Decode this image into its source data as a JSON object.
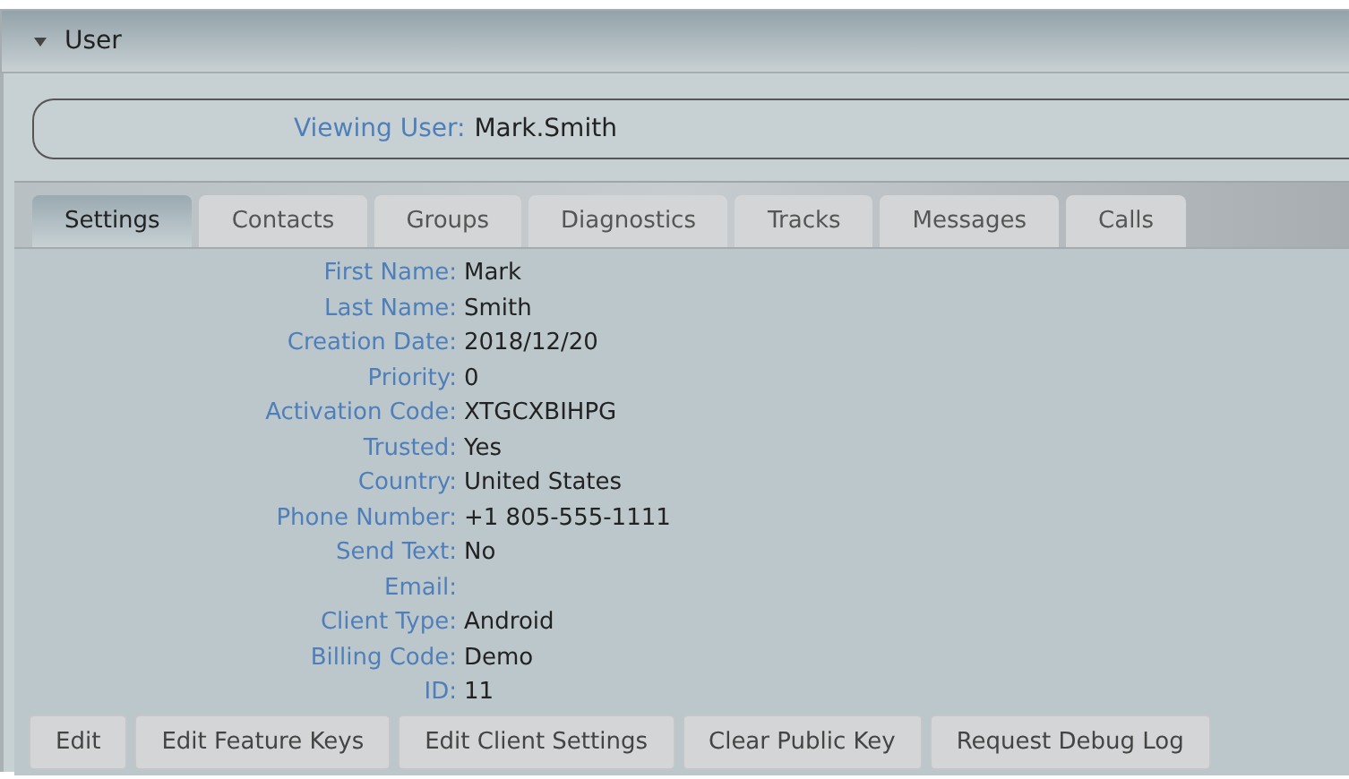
{
  "panel": {
    "title": "User",
    "expanded": true
  },
  "viewing": {
    "label": "Viewing User:",
    "value": "Mark.Smith"
  },
  "tabs": [
    {
      "label": "Settings",
      "selected": true
    },
    {
      "label": "Contacts",
      "selected": false
    },
    {
      "label": "Groups",
      "selected": false
    },
    {
      "label": "Diagnostics",
      "selected": false
    },
    {
      "label": "Tracks",
      "selected": false
    },
    {
      "label": "Messages",
      "selected": false
    },
    {
      "label": "Calls",
      "selected": false
    }
  ],
  "fields": [
    {
      "label": "First Name:",
      "value": "Mark"
    },
    {
      "label": "Last Name:",
      "value": "Smith"
    },
    {
      "label": "Creation Date:",
      "value": "2018/12/20"
    },
    {
      "label": "Priority:",
      "value": "0"
    },
    {
      "label": "Activation Code:",
      "value": "XTGCXBIHPG"
    },
    {
      "label": "Trusted:",
      "value": "Yes"
    },
    {
      "label": "Country:",
      "value": "United States"
    },
    {
      "label": "Phone Number:",
      "value": "+1 805-555-1111"
    },
    {
      "label": "Send Text:",
      "value": "No"
    },
    {
      "label": "Email:"
    },
    {
      "label": "Client Type:",
      "value": "Android"
    },
    {
      "label": "Billing Code:",
      "value": "Demo"
    },
    {
      "label": "ID:",
      "value": "11"
    }
  ],
  "buttons": [
    "Edit",
    "Edit Feature Keys",
    "Edit Client Settings",
    "Clear Public Key",
    "Request Debug Log"
  ]
}
